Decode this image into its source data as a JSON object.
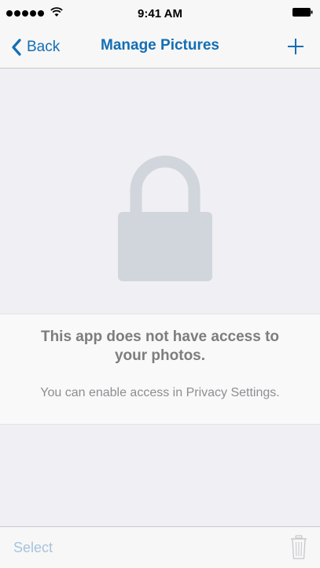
{
  "status_bar": {
    "time": "9:41 AM",
    "signal_icon": "signal-dots-icon",
    "wifi_icon": "wifi-icon",
    "battery_icon": "battery-icon"
  },
  "nav": {
    "back_label": "Back",
    "back_icon": "chevron-left-icon",
    "title": "Manage Pictures",
    "add_icon": "plus-icon"
  },
  "empty_state": {
    "icon": "lock-icon",
    "title": "This app does not have access to your photos.",
    "subtitle": "You can enable access in Privacy Settings."
  },
  "toolbar": {
    "select_label": "Select",
    "trash_icon": "trash-icon"
  },
  "colors": {
    "accent": "#146eb4",
    "disabled_accent": "#a7c3dc",
    "lock": "#d1d5dc",
    "background": "#efeff4"
  }
}
